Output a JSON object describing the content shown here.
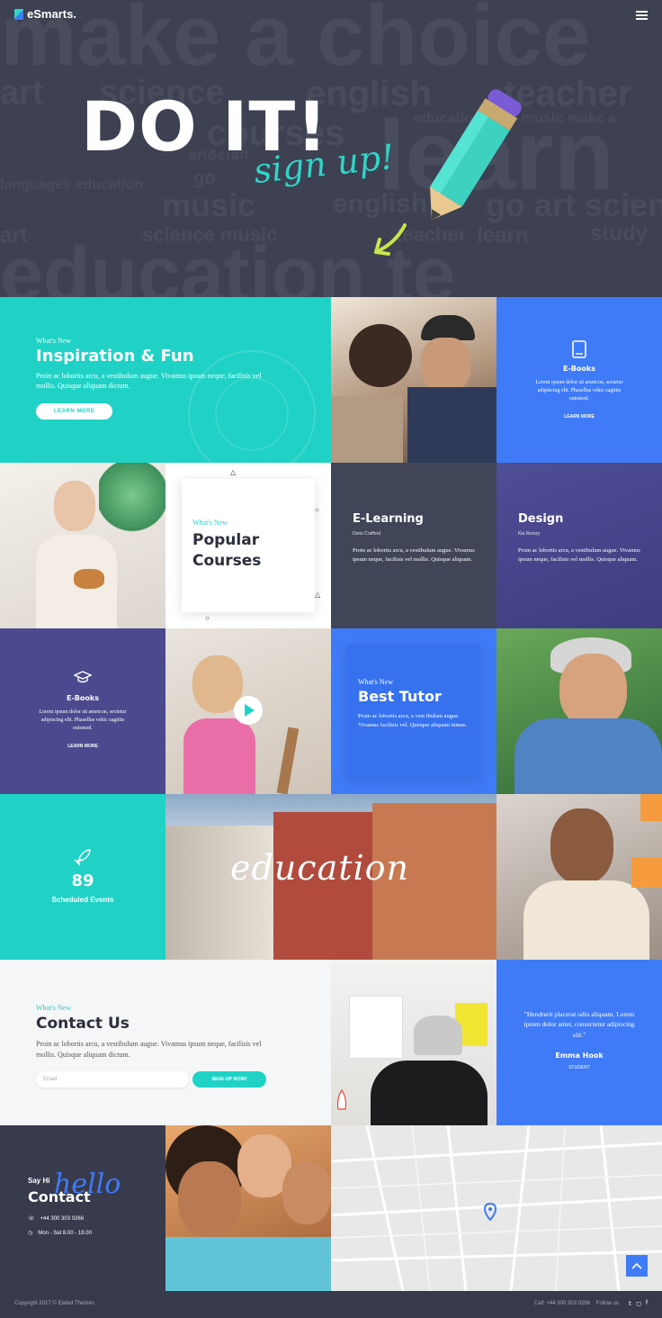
{
  "header": {
    "logo": "eSmarts.",
    "menu_icon": "hamburger-icon"
  },
  "hero": {
    "title": "DO IT!",
    "script": "sign up!",
    "bg_words": [
      "make a choice",
      "art",
      "science",
      "english",
      "teacher",
      "learn",
      "education",
      "music make a",
      "courses",
      "art&craft",
      "languages education",
      "go",
      "music",
      "english",
      "go art science",
      "art",
      "science music",
      "teacher",
      "learn",
      "study",
      "education te"
    ]
  },
  "inspiration": {
    "kicker": "What's New",
    "title": "Inspiration & Fun",
    "text": "Proin ac lobortis arcu, a vestibulum augue. Vivamus ipsum neque, facilisis vel mollis. Quisque aliquam dictum.",
    "button": "LEARN MORE"
  },
  "ebooks_1": {
    "icon": "book-icon",
    "title": "E-Books",
    "text": "Lorem ipsum dolor sit ametcon, sectetur adipiscing elit. Phasellus vehic sagittis euismod.",
    "link": "LEARN MORE"
  },
  "popular": {
    "kicker": "What's New",
    "title_1": "Popular",
    "title_2": "Courses"
  },
  "elearning": {
    "title": "E-Learning",
    "author": "Doris Crafford",
    "text": "Proin ac lobortis arcu, a vestibulum augue. Vivamus ipsum neque, facilisis vel mollis. Quisque aliquam."
  },
  "design": {
    "title": "Design",
    "author": "Kia Remzy",
    "text": "Proin ac lobortis arcu, a vestibulum augue. Vivamus ipsum neque, facilisis vel mollis. Quisque aliquam."
  },
  "ebooks_2": {
    "icon": "graduation-cap-icon",
    "title": "E-Books",
    "text": "Lorem ipsum dolor sit ametcon, sectetur adipiscing elit. Phasellus vehic sagittis euismod.",
    "link": "LEARN MORE"
  },
  "tutor": {
    "kicker": "What's New",
    "title": "Best Tutor",
    "text": "Proin ac lobortis arcu, a vest ibulum augue. Vivamus facilisis vel. Quisque aliquam iumus."
  },
  "events": {
    "icon": "rocket-icon",
    "count": "89",
    "label": "Scheduled Events"
  },
  "education_script": "education",
  "contact_form": {
    "kicker": "What's New",
    "title": "Contact Us",
    "text": "Proin ac lobortis arcu, a vestibulum augue. Vivamus ipsum neque, facilisis vel mollis. Quisque aliquam dictum.",
    "email_placeholder": "Email",
    "button": "SIGN UP NOW!"
  },
  "quote": {
    "text": "\"Hendrerit placerat odio aliquam. Lorem ipsum dolor amet, consectetur adipiscing elit.\"",
    "name": "Emma Hook",
    "role": "STUDENT"
  },
  "contact": {
    "kicker": "Say Hi",
    "script": "hello",
    "title": "Contact",
    "phone": "+44 300 303 0266",
    "hours": "Mon - Sat 8.00 - 18.00"
  },
  "footer": {
    "copyright": "Copyright 2017 © Elated Themes",
    "call": "Call: +44 300 303 0266",
    "follow": "Follow us"
  },
  "colors": {
    "teal": "#1fd2c5",
    "blue": "#3f7bf7",
    "dark": "#404558",
    "purple": "#4b4a8f"
  }
}
